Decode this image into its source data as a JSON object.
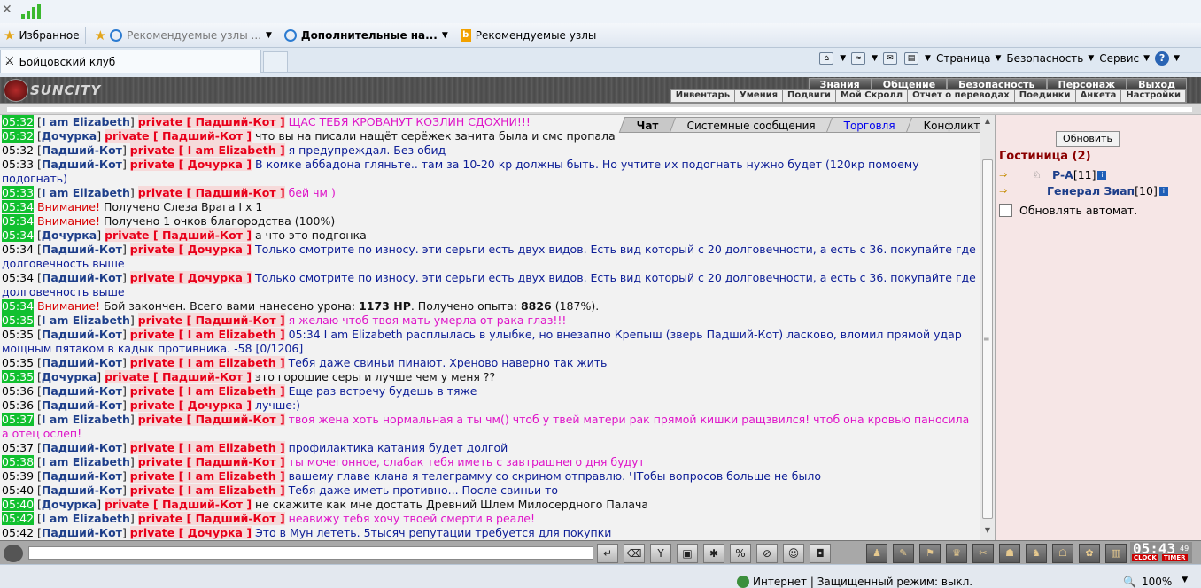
{
  "browser": {
    "favorites_bar": {
      "favorites_label": "Избранное",
      "items": [
        "Рекомендуемые узлы ...",
        "Дополнительные на...",
        "Рекомендуемые узлы"
      ]
    },
    "tab_title": "Бойцовский клуб",
    "command_bar": {
      "page": "Страница",
      "safety": "Безопасность",
      "service": "Сервис"
    },
    "status_bar": {
      "text": "Интернет | Защищенный режим: выкл.",
      "zoom": "100%"
    }
  },
  "game": {
    "logo_text": "SUNCITY",
    "menu_top": [
      "Знания",
      "Общение",
      "Безопасность",
      "Персонаж",
      "Выход"
    ],
    "menu_sub": [
      "Инвентарь",
      "Умения",
      "Подвиги",
      "Мой Скролл",
      "Отчет о переводах",
      "Поединки",
      "Анкета",
      "Настройки"
    ],
    "chat_tabs": [
      "Чат",
      "Системные сообщения",
      "Торговля",
      "Конфликты"
    ],
    "chat_lines": [
      {
        "t": "05:32",
        "hl": true,
        "from": "I am Elizabeth",
        "to": "Падший-Кот",
        "msg": "ЩАС ТЕБЯ КРОВАНУТ КОЗЛИН СДОХНИ!!!",
        "style": "pink"
      },
      {
        "t": "05:32",
        "hl": true,
        "from": "Дочурка",
        "to": "Падший-Кот",
        "msg": "что вы на писали нащёт серёжек занита была и смс пропала",
        "style": "dark"
      },
      {
        "t": "05:32",
        "hl": false,
        "from": "Падший-Кот",
        "to": "I am Elizabeth",
        "msg": "я предупреждал. Без обид",
        "style": "blue"
      },
      {
        "t": "05:33",
        "hl": false,
        "from": "Падший-Кот",
        "to": "Дочурка",
        "msg": "В комке аббадона гляньте.. там за 10-20 кр должны быть. Но учтите их подогнать нужно будет (120кр помоему подогнать)",
        "style": "blue"
      },
      {
        "t": "05:33",
        "hl": true,
        "from": "I am Elizabeth",
        "to": "Падший-Кот",
        "msg": "бей чм )",
        "style": "pink"
      },
      {
        "t": "05:34",
        "hl": true,
        "sys": "Внимание!",
        "msg": "Получено Слеза Врага I x 1"
      },
      {
        "t": "05:34",
        "hl": true,
        "sys": "Внимание!",
        "msg": "Получено 1 очков благородства (100%)"
      },
      {
        "t": "05:34",
        "hl": true,
        "from": "Дочурка",
        "to": "Падший-Кот",
        "msg": "а что это подгонка",
        "style": "dark"
      },
      {
        "t": "05:34",
        "hl": false,
        "from": "Падший-Кот",
        "to": "Дочурка",
        "msg": "Только смотрите по износу. эти серьги есть двух видов. Есть вид который с 20 долговечности, а есть с 36. покупайте где долговечность выше",
        "style": "blue"
      },
      {
        "t": "05:34",
        "hl": false,
        "from": "Падший-Кот",
        "to": "Дочурка",
        "msg": "Только смотрите по износу. эти серьги есть двух видов. Есть вид который с 20 долговечности, а есть с 36. покупайте где долговечность выше",
        "style": "blue"
      },
      {
        "t": "05:34",
        "hl": true,
        "sys": "Внимание!",
        "battle": {
          "pre": "Бой закончен. Всего вами нанесено урона: ",
          "dmg": "1173 HP",
          "mid": ". Получено опыта: ",
          "exp": "8826",
          "post": " (187%)."
        }
      },
      {
        "t": "05:35",
        "hl": true,
        "from": "I am Elizabeth",
        "to": "Падший-Кот",
        "msg": "я желаю чтоб твоя мать умерла от рака глаз!!!",
        "style": "pink"
      },
      {
        "t": "05:35",
        "hl": false,
        "from": "Падший-Кот",
        "to": "I am Elizabeth",
        "msg": "05:34 I am Elizabeth расплылась в улыбке, но внезапно Крепыш (зверь Падший-Кот) ласково, вломил прямой удар мощным пятаком в кадык противника. -58 [0/1206]",
        "style": "blue"
      },
      {
        "t": "05:35",
        "hl": false,
        "from": "Падший-Кот",
        "to": "I am Elizabeth",
        "msg": "Тебя даже свиньи пинают. Хреново наверно так жить",
        "style": "blue"
      },
      {
        "t": "05:35",
        "hl": true,
        "from": "Дочурка",
        "to": "Падший-Кот",
        "msg": "это горошие серьги лучше чем у меня ??",
        "style": "dark"
      },
      {
        "t": "05:36",
        "hl": false,
        "from": "Падший-Кот",
        "to": "I am Elizabeth",
        "msg": "Еще раз встречу будешь в тяже",
        "style": "blue"
      },
      {
        "t": "05:36",
        "hl": false,
        "from": "Падший-Кот",
        "to": "Дочурка",
        "msg": "лучше:)",
        "style": "blue"
      },
      {
        "t": "05:37",
        "hl": true,
        "from": "I am Elizabeth",
        "to": "Падший-Кот",
        "msg": "твоя жена хоть нормальная а ты чм() чтоб у твей матери рак прямой кишки ращзвился! чтоб она кровью паносила а отец ослеп!",
        "style": "pink"
      },
      {
        "t": "05:37",
        "hl": false,
        "from": "Падший-Кот",
        "to": "I am Elizabeth",
        "msg": "профилактика катания будет долгой",
        "style": "blue"
      },
      {
        "t": "05:38",
        "hl": true,
        "from": "I am Elizabeth",
        "to": "Падший-Кот",
        "msg": "ты мочегонное, слабак тебя иметь с завтрашнего дня будут",
        "style": "pink"
      },
      {
        "t": "05:39",
        "hl": false,
        "from": "Падший-Кот",
        "to": "I am Elizabeth",
        "msg": "вашему главе клана я телеграмму со скрином отправлю. ЧТобы вопросов больше не было",
        "style": "blue"
      },
      {
        "t": "05:40",
        "hl": false,
        "from": "Падший-Кот",
        "to": "I am Elizabeth",
        "msg": "Тебя даже иметь противно... После свиньи то",
        "style": "blue"
      },
      {
        "t": "05:40",
        "hl": true,
        "from": "Дочурка",
        "to": "Падший-Кот",
        "msg": "не скажите как мне достать Древний Шлем Милосердного Палача",
        "style": "dark"
      },
      {
        "t": "05:42",
        "hl": true,
        "from": "I am Elizabeth",
        "to": "Падший-Кот",
        "msg": "неавижу тебя хочу твоей смерти в реале!",
        "style": "pink"
      },
      {
        "t": "05:42",
        "hl": false,
        "from": "Падший-Кот",
        "to": "Дочурка",
        "msg": "Это в Мун лететь. 5тысяч репутации требуется для покупки",
        "style": "blue"
      }
    ],
    "right_panel": {
      "refresh_button": "Обновить",
      "room_title": "Гостиница (2)",
      "users": [
        {
          "name": "P-A",
          "level": "[11]"
        },
        {
          "name": "Генерал Зиап",
          "level": "[10]"
        }
      ],
      "auto_refresh_label": "Обновлять автомат."
    },
    "clock": {
      "time": "05:43",
      "seconds": "49",
      "clock_label": "CLOCK",
      "timer_label": "TIMER"
    }
  }
}
